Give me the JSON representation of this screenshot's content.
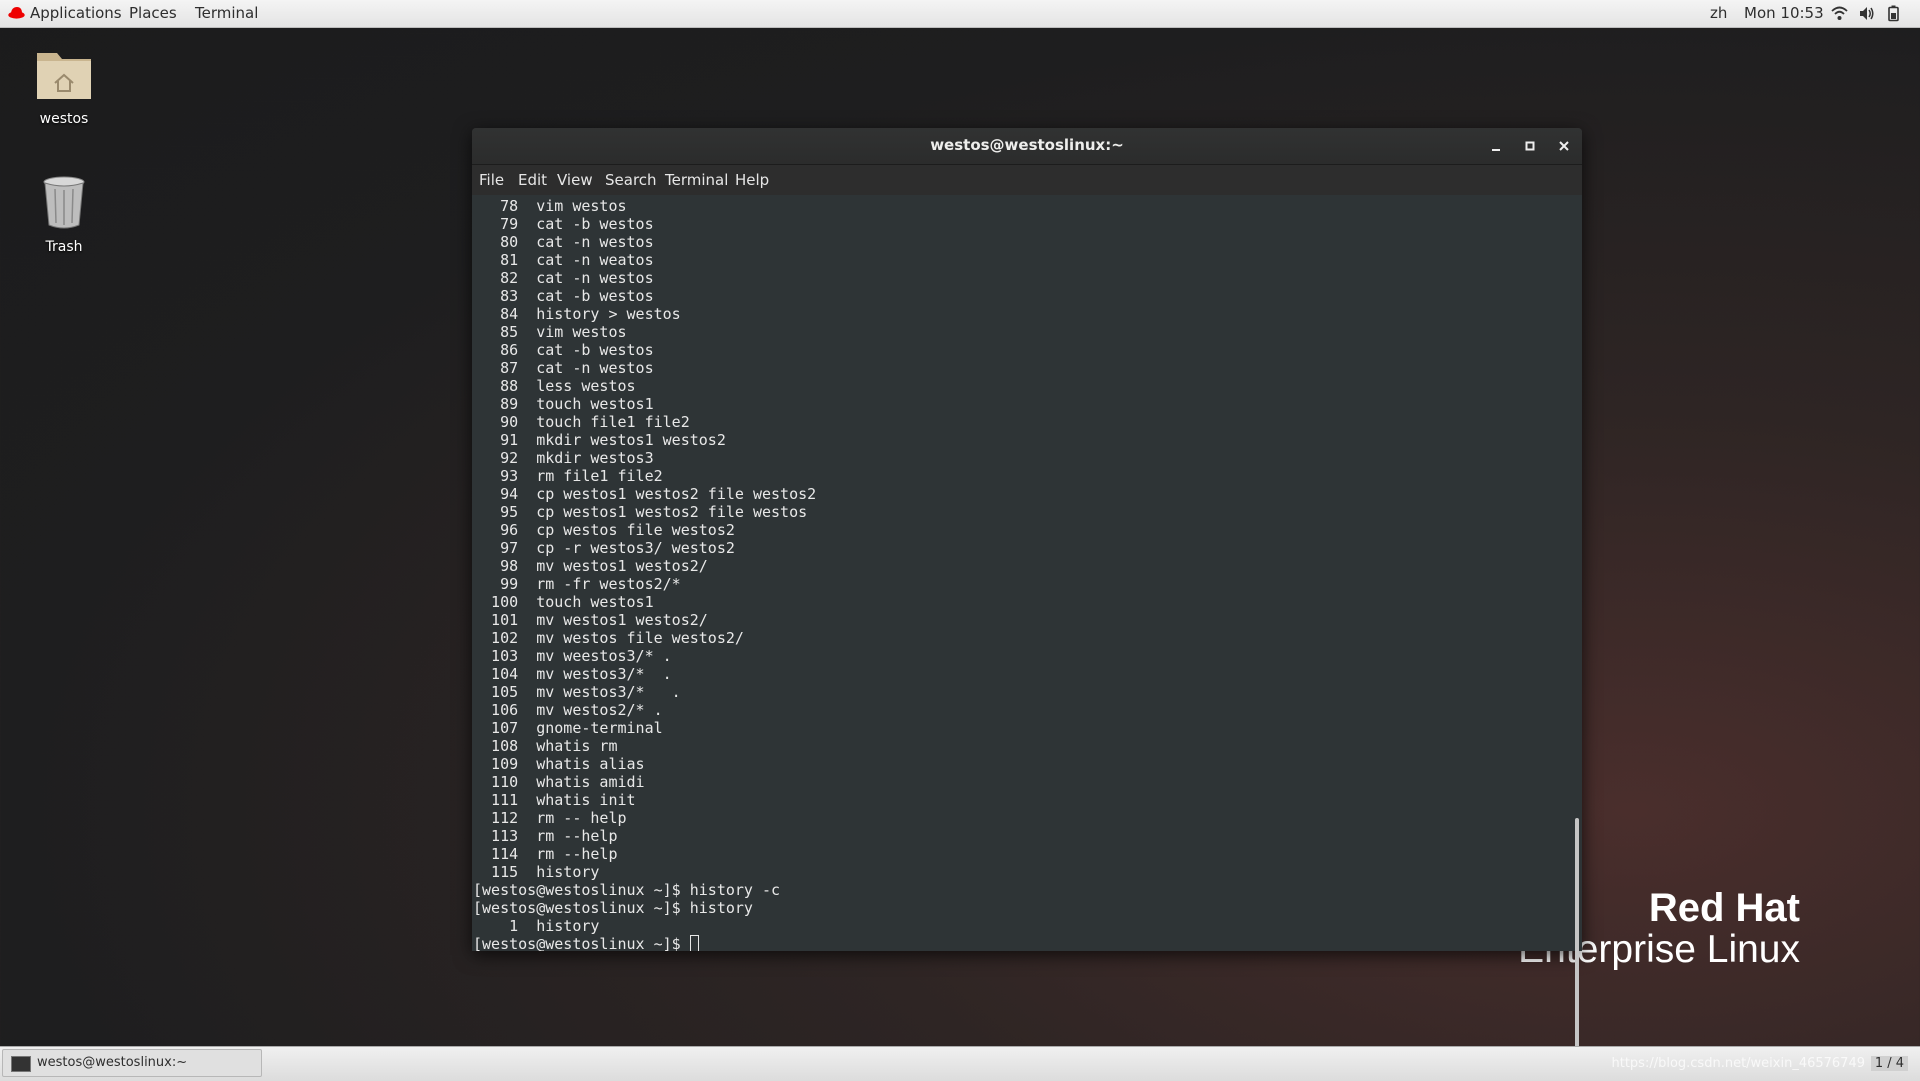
{
  "topbar": {
    "applications": "Applications",
    "places": "Places",
    "terminal": "Terminal",
    "lang": "zh",
    "clock": "Mon 10:53",
    "icons": [
      "wifi-icon",
      "volume-icon",
      "battery-icon"
    ]
  },
  "desktop": {
    "icons": [
      {
        "label": "westos",
        "icon": "home-folder-icon"
      },
      {
        "label": "Trash",
        "icon": "trash-icon"
      }
    ],
    "brand_line1": "Red Hat",
    "brand_line2": "Enterprise Linux"
  },
  "window": {
    "title": "westos@westoslinux:~",
    "menu": [
      "File",
      "Edit",
      "View",
      "Search",
      "Terminal",
      "Help"
    ],
    "lines": [
      "   78  vim westos",
      "   79  cat -b westos",
      "   80  cat -n westos",
      "   81  cat -n weatos",
      "   82  cat -n westos",
      "   83  cat -b westos",
      "   84  history > westos",
      "   85  vim westos",
      "   86  cat -b westos",
      "   87  cat -n westos",
      "   88  less westos",
      "   89  touch westos1",
      "   90  touch file1 file2",
      "   91  mkdir westos1 westos2",
      "   92  mkdir westos3",
      "   93  rm file1 file2",
      "   94  cp westos1 westos2 file westos2",
      "   95  cp westos1 westos2 file westos",
      "   96  cp westos file westos2",
      "   97  cp -r westos3/ westos2",
      "   98  mv westos1 westos2/",
      "   99  rm -fr westos2/*",
      "  100  touch westos1",
      "  101  mv westos1 westos2/",
      "  102  mv westos file westos2/",
      "  103  mv weestos3/* .",
      "  104  mv westos3/*  .",
      "  105  mv westos3/*   .",
      "  106  mv westos2/* .",
      "  107  gnome-terminal",
      "  108  whatis rm",
      "  109  whatis alias",
      "  110  whatis amidi",
      "  111  whatis init",
      "  112  rm -- help",
      "  113  rm --help",
      "  114  rm --help",
      "  115  history",
      "[westos@westoslinux ~]$ history -c",
      "[westos@westoslinux ~]$ history",
      "    1  history"
    ],
    "prompt": "[westos@westoslinux ~]$ "
  },
  "taskbar": {
    "task_label": "westos@westoslinux:~",
    "workspace": "1 / 4",
    "watermark": "https://blog.csdn.net/weixin_46576749"
  },
  "colors": {
    "terminal_bg": "#2e3436",
    "terminal_fg": "#e8e8e8",
    "redhat_red": "#ee0000"
  }
}
